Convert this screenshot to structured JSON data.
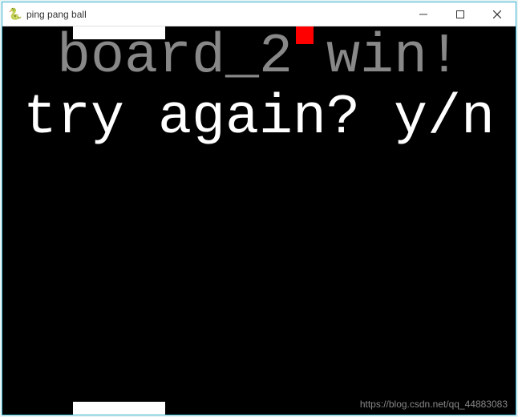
{
  "window": {
    "title": "ping pang ball",
    "icon": "🐍"
  },
  "game": {
    "win_message": "board_2 win!",
    "prompt_message": "try again? y/n"
  },
  "watermark": "https://blog.csdn.net/qq_44883083"
}
